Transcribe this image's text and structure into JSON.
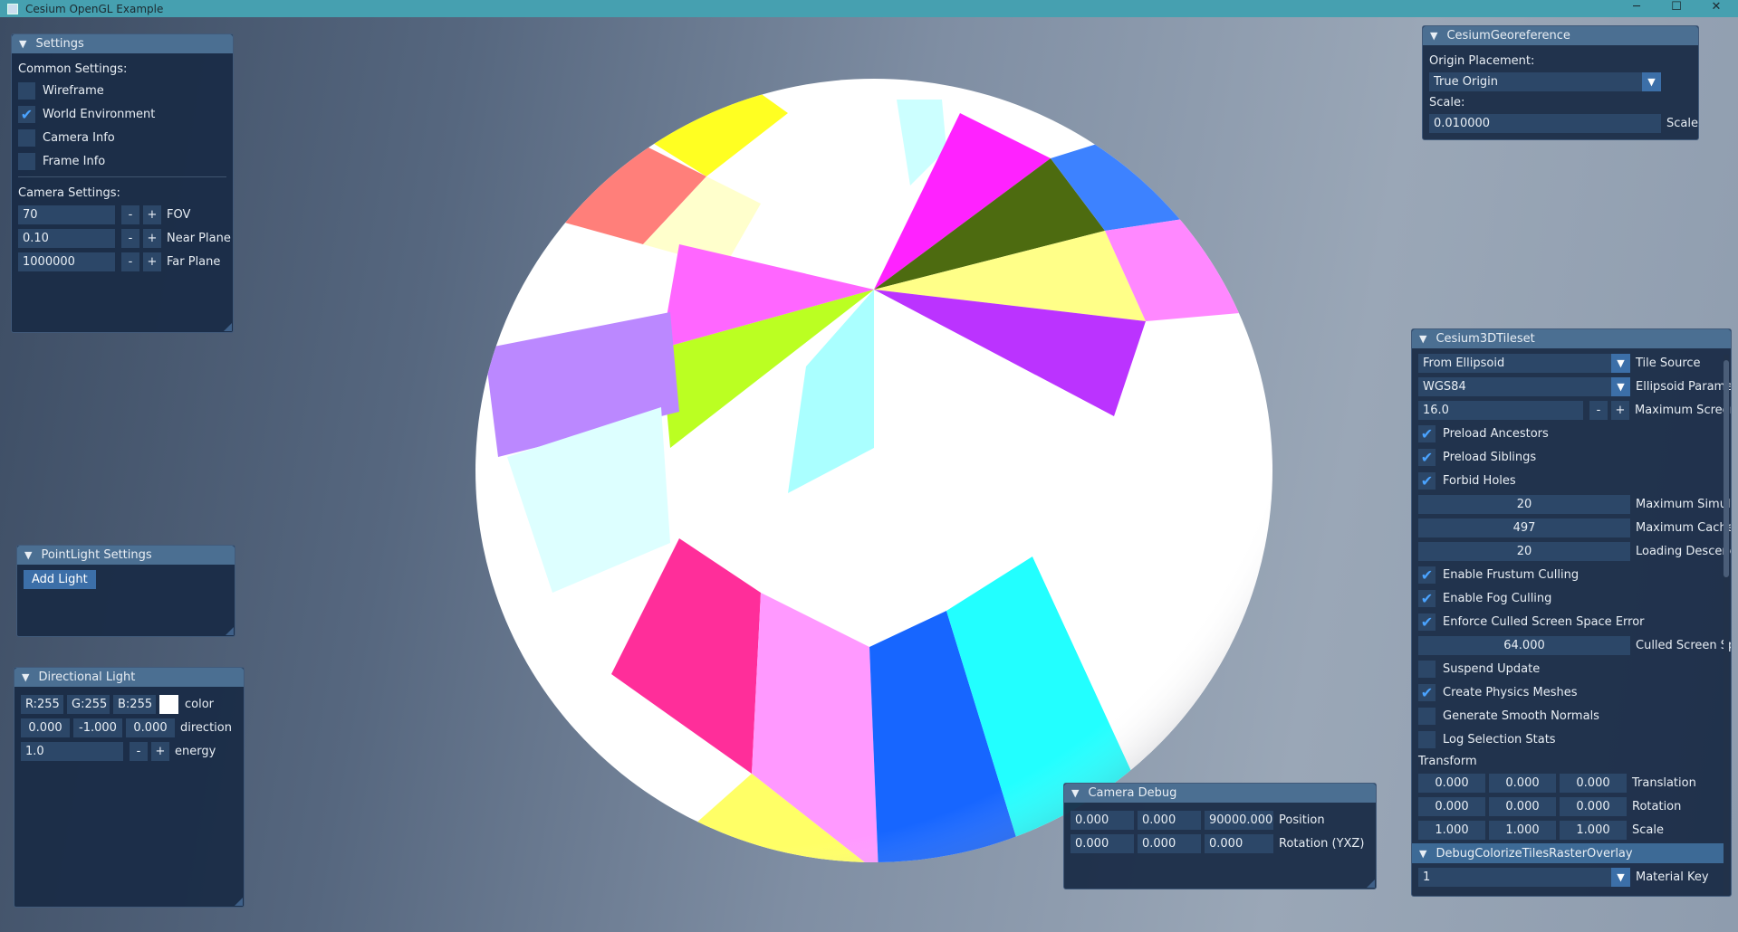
{
  "window": {
    "title": "Cesium OpenGL Example",
    "minimize": "─",
    "maximize": "☐",
    "close": "✕"
  },
  "settings": {
    "title": "Settings",
    "common_label": "Common Settings:",
    "checks": [
      {
        "label": "Wireframe",
        "checked": false
      },
      {
        "label": "World Environment",
        "checked": true
      },
      {
        "label": "Camera Info",
        "checked": false
      },
      {
        "label": "Frame Info",
        "checked": false
      }
    ],
    "camera_label": "Camera Settings:",
    "fov": {
      "value": "70",
      "label": "FOV"
    },
    "near": {
      "value": "0.10",
      "label": "Near Plane"
    },
    "far": {
      "value": "1000000",
      "label": "Far Plane"
    },
    "minus": "-",
    "plus": "+"
  },
  "pointlight": {
    "title": "PointLight Settings",
    "add_label": "Add Light"
  },
  "directional": {
    "title": "Directional Light",
    "r": "R:255",
    "g": "G:255",
    "b": "B:255",
    "color_label": "color",
    "swatch": "#ffffff",
    "dir_x": "0.000",
    "dir_y": "-1.000",
    "dir_z": "0.000",
    "direction_label": "direction",
    "energy": "1.0",
    "energy_label": "energy"
  },
  "georef": {
    "title": "CesiumGeoreference",
    "origin_label": "Origin Placement:",
    "origin_value": "True Origin",
    "scale_label": "Scale:",
    "scale_value": "0.010000",
    "scale_suffix": "Scale"
  },
  "camera_debug": {
    "title": "Camera Debug",
    "pos": [
      "0.000",
      "0.000",
      "90000.000"
    ],
    "pos_label": "Position",
    "rot": [
      "0.000",
      "0.000",
      "0.000"
    ],
    "rot_label": "Rotation (YXZ)"
  },
  "tileset": {
    "title": "Cesium3DTileset",
    "source": {
      "value": "From Ellipsoid",
      "label": "Tile Source"
    },
    "ellipsoid": {
      "value": "WGS84",
      "label": "Ellipsoid Paramet"
    },
    "max_sse": {
      "value": "16.0",
      "label": "Maximum Screer"
    },
    "checks_a": [
      {
        "label": "Preload Ancestors",
        "checked": true
      },
      {
        "label": "Preload Siblings",
        "checked": true
      },
      {
        "label": "Forbid Holes",
        "checked": true
      }
    ],
    "max_sim": {
      "value": "20",
      "label": "Maximum Simult"
    },
    "max_cache": {
      "value": "497",
      "label": "Maximum Cache"
    },
    "loading_desc": {
      "value": "20",
      "label": "Loading Descenc"
    },
    "checks_b": [
      {
        "label": "Enable Frustum Culling",
        "checked": true
      },
      {
        "label": "Enable Fog Culling",
        "checked": true
      },
      {
        "label": "Enforce Culled Screen Space Error",
        "checked": true
      }
    ],
    "culled_sse": {
      "value": "64.000",
      "label": "Culled Screen Sp"
    },
    "checks_c": [
      {
        "label": "Suspend Update",
        "checked": false
      },
      {
        "label": "Create Physics Meshes",
        "checked": true
      },
      {
        "label": "Generate Smooth Normals",
        "checked": false
      },
      {
        "label": "Log Selection Stats",
        "checked": false
      }
    ],
    "transform_label": "Transform",
    "translation": [
      "0.000",
      "0.000",
      "0.000"
    ],
    "translation_label": "Translation",
    "rotation": [
      "0.000",
      "0.000",
      "0.000"
    ],
    "rotation_label": "Rotation",
    "scale": [
      "1.000",
      "1.000",
      "1.000"
    ],
    "scale_label": "Scale",
    "overlay_title": "DebugColorizeTilesRasterOverlay",
    "material": {
      "value": "1",
      "label": "Material Key"
    }
  },
  "colors": {
    "panel_bg": "#1a2c46",
    "panel_head": "#4b6f92",
    "field_bg": "#2c4768",
    "accent": "#3c6fa8",
    "check": "#4aa3ff",
    "titlebar": "#46a0b0"
  }
}
